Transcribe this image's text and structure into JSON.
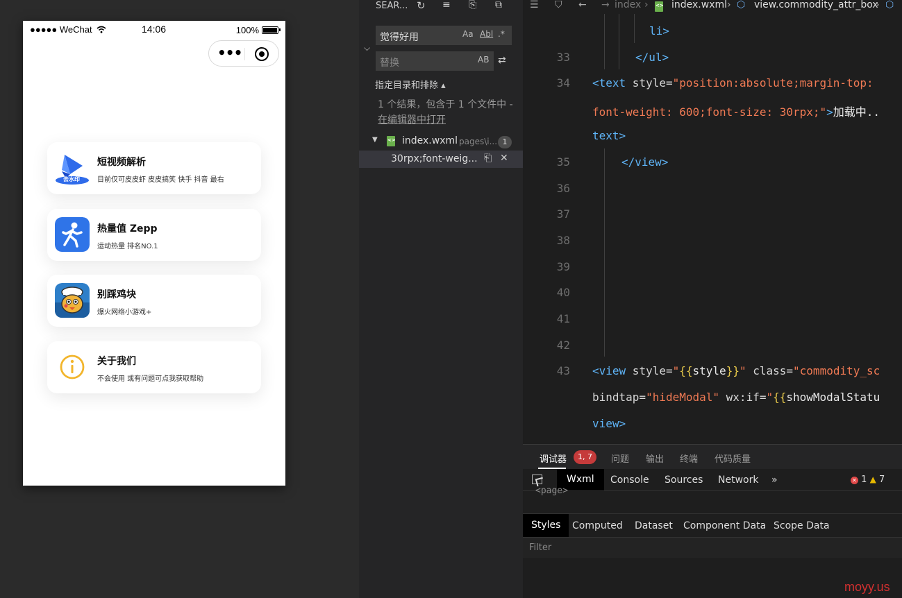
{
  "simulator": {
    "status": {
      "carrier": "●●●●● WeChat",
      "time": "14:06",
      "battery": "100%"
    },
    "cards": [
      {
        "title": "短视频解析",
        "desc": "目前仅可皮皮虾 皮皮搞笑 快手 抖音 最右",
        "icon_badge": "去水印",
        "icon": "video-parse-icon"
      },
      {
        "title": "热量值 Zepp",
        "desc": "运动热量 排名NO.1",
        "icon": "running-man-icon"
      },
      {
        "title": "别踩鸡块",
        "desc": "爆火网络小游戏+",
        "icon": "chicken-game-icon"
      },
      {
        "title": "关于我们",
        "desc": "不会使用 或有问题可点我获取帮助",
        "icon": "info-icon"
      }
    ]
  },
  "search": {
    "title": "SEAR...",
    "query": "觉得好用",
    "replace_placeholder": "替换",
    "opt_case": "Aa",
    "opt_word": "Abl",
    "opt_regex": ".*",
    "opt_preserve": "AB",
    "scope_label": "指定目录和排除",
    "result_summary": "1 个结果，包含于 1 个文件中 - ",
    "open_in_editor": "在编辑器中打开",
    "file_name": "index.wxml",
    "file_path": "pages\\i...",
    "file_count": "1",
    "match_text": "30rpx;font-weig..."
  },
  "editor": {
    "breadcrumb": [
      "index",
      "index.wxml",
      "view.commodity_attr_box"
    ],
    "line33": "33",
    "line34": "34",
    "line35": "35",
    "line36": "36",
    "line37": "37",
    "line38": "38",
    "line39": "39",
    "line40": "40",
    "line41": "41",
    "line42": "42",
    "line43": "43",
    "code_li": "li>",
    "code_ul_close": "</ul>",
    "l34_tag": "<text",
    "l34_attr": " style=",
    "l34_str": "\"position:absolute;margin-top:",
    "l34b_str": "font-weight: 600;font-size: 30rpx;\"",
    "l34b_tag": ">",
    "l34b_txt": "加载中..",
    "l34c_tag": "text>",
    "l35": "</view>",
    "l43_tag": "<view",
    "l43_attr1": " style=",
    "l43_q1": "\"",
    "l43_b1": "{{",
    "l43_v1": "style",
    "l43_b2": "}}",
    "l43_q2": "\"",
    "l43_attr2": " class=",
    "l43_str2": "\"commodity_sc",
    "l43b_attr": "bindtap=",
    "l43b_str": "\"hideModal\"",
    "l43b_attr2": " wx:if=",
    "l43b_q": "\"",
    "l43b_b": "{{",
    "l43b_v": "showModalStatu",
    "l43c_tag": "view>"
  },
  "devtools": {
    "tabs": [
      "调试器",
      "问题",
      "输出",
      "终端",
      "代码质量"
    ],
    "error_badge": "1, 7",
    "panels": [
      "Wxml",
      "Console",
      "Sources",
      "Network",
      "»"
    ],
    "errors": "1",
    "warnings": "7",
    "tree_node": "<page>",
    "sub_tabs": [
      "Styles",
      "Computed",
      "Dataset",
      "Component Data",
      "Scope Data"
    ],
    "filter_placeholder": "Filter",
    "watermark": "moyy.us"
  }
}
